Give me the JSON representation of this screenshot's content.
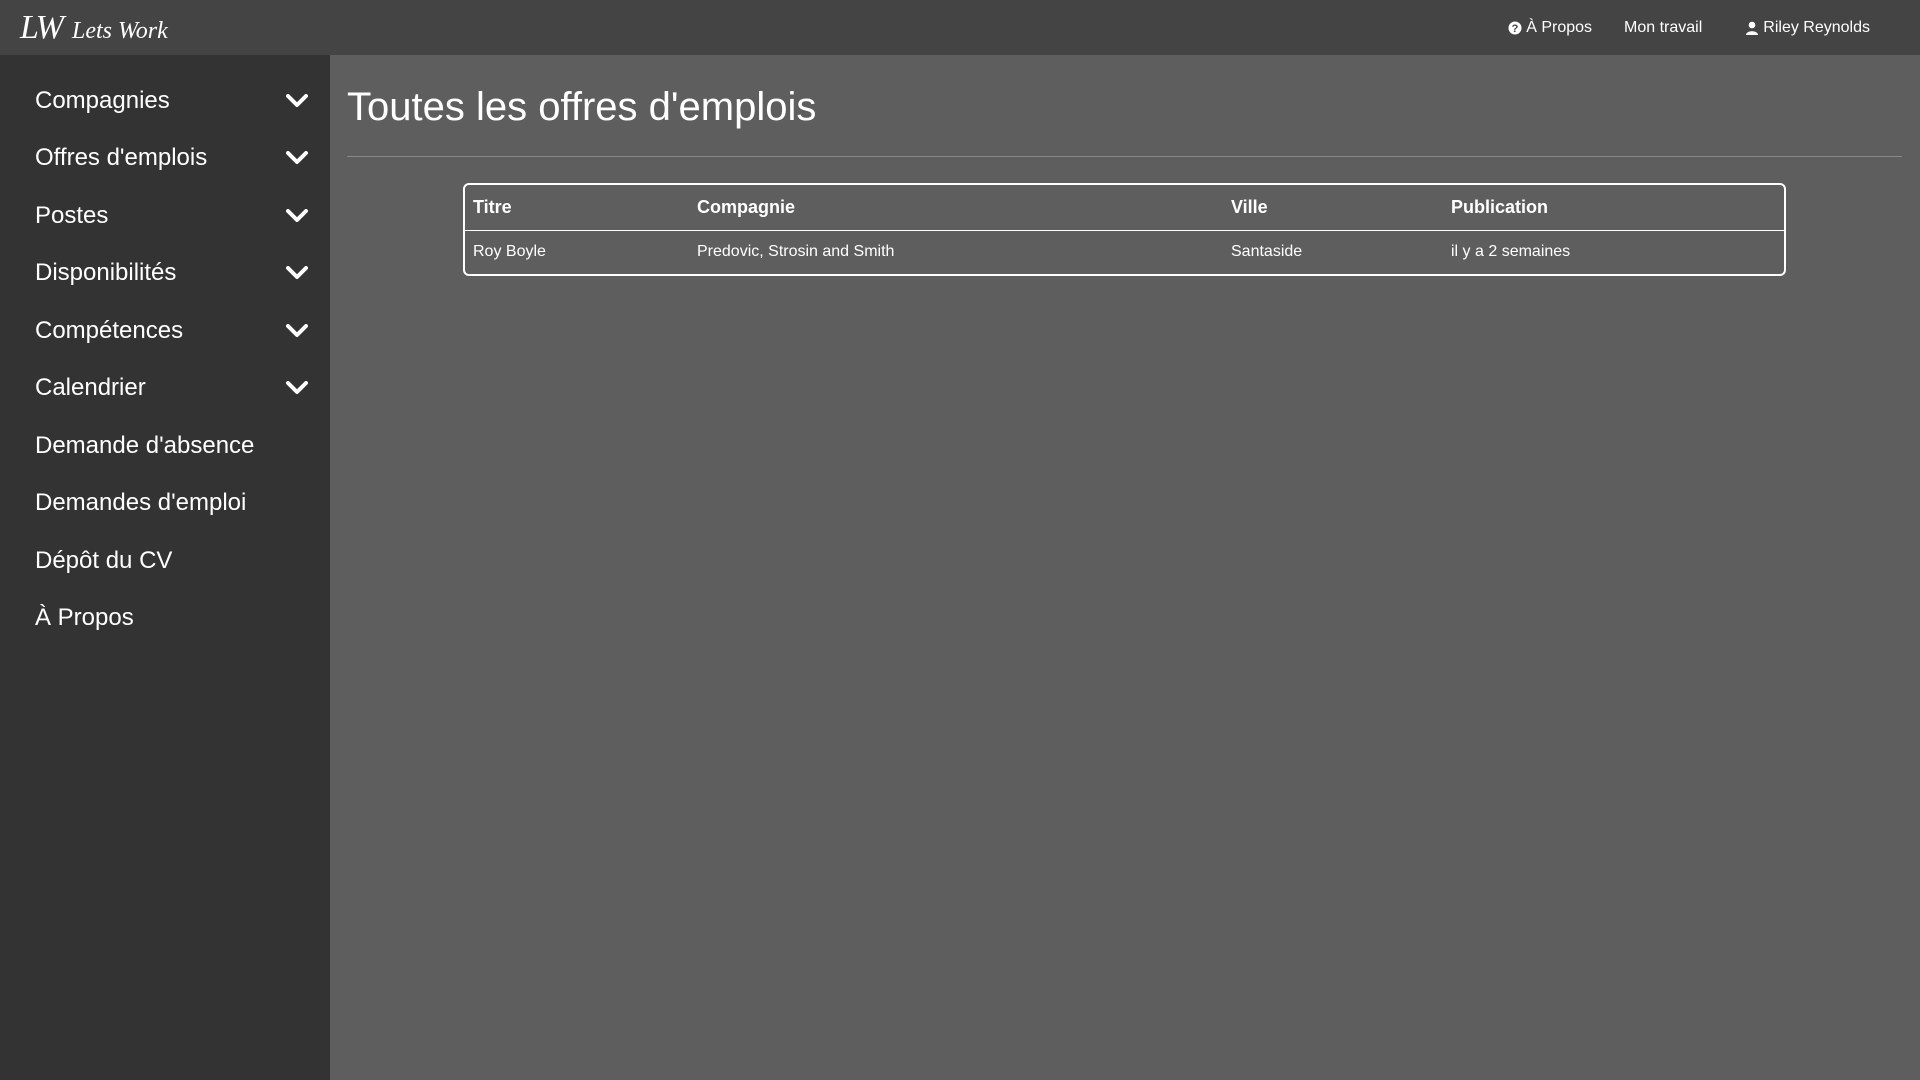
{
  "app": {
    "logo_mark": "LW",
    "logo_name": "Lets Work"
  },
  "topnav": {
    "about_label": "À Propos",
    "mywork_label": "Mon travail",
    "user_label": "Riley Reynolds"
  },
  "sidebar": {
    "items": [
      {
        "label": "Compagnies",
        "expandable": true
      },
      {
        "label": "Offres d'emplois",
        "expandable": true
      },
      {
        "label": "Postes",
        "expandable": true
      },
      {
        "label": "Disponibilités",
        "expandable": true
      },
      {
        "label": "Compétences",
        "expandable": true
      },
      {
        "label": "Calendrier",
        "expandable": true
      },
      {
        "label": "Demande d'absence",
        "expandable": false
      },
      {
        "label": "Demandes d'emploi",
        "expandable": false
      },
      {
        "label": "Dépôt du CV",
        "expandable": false
      },
      {
        "label": "À Propos",
        "expandable": false
      }
    ]
  },
  "main": {
    "title": "Toutes les offres d'emplois",
    "table": {
      "headers": [
        "Titre",
        "Compagnie",
        "Ville",
        "Publication"
      ],
      "rows": [
        [
          "Roy Boyle",
          "Predovic, Strosin and Smith",
          "Santaside",
          "il y a 2 semaines"
        ]
      ]
    }
  },
  "colors": {
    "topbar_bg": "#444444",
    "sidebar_bg": "#333333",
    "main_bg": "#5e5e5e",
    "text": "#ffffff"
  },
  "icons": {
    "about": "question-circle-icon",
    "user": "user-icon",
    "expand": "chevron-down-icon"
  }
}
